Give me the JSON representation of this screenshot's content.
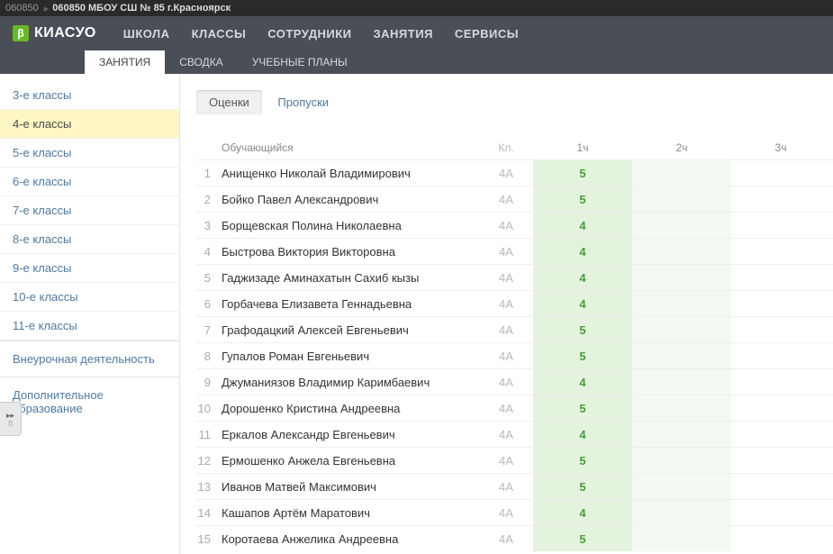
{
  "topbar": {
    "code": "060850",
    "title": "060850 МБОУ СШ № 85 г.Красноярск"
  },
  "logo": {
    "badge": "β",
    "text": "КИАСУО"
  },
  "mainnav": [
    "ШКОЛА",
    "КЛАССЫ",
    "СОТРУДНИКИ",
    "ЗАНЯТИЯ",
    "СЕРВИСЫ"
  ],
  "subnav": {
    "items": [
      "ЗАНЯТИЯ",
      "СВОДКА",
      "УЧЕБНЫЕ ПЛАНЫ"
    ],
    "active": 0
  },
  "sidebar": {
    "classes": [
      "3-е классы",
      "4-е классы",
      "5-е классы",
      "6-е классы",
      "7-е классы",
      "8-е классы",
      "9-е классы",
      "10-е классы",
      "11-е классы"
    ],
    "active": 1,
    "sections": [
      "Внеурочная деятельность",
      "Дополнительное образование"
    ]
  },
  "tabs": {
    "items": [
      "Оценки",
      "Пропуски"
    ],
    "active": 0
  },
  "table": {
    "headers": {
      "student": "Обучающийся",
      "class": "Кл.",
      "h1": "1ч",
      "h2": "2ч",
      "h3": "3ч"
    },
    "rows": [
      {
        "n": 1,
        "name": "Анищенко Николай Владимирович",
        "class": "4А",
        "g1": "5"
      },
      {
        "n": 2,
        "name": "Бойко Павел Александрович",
        "class": "4А",
        "g1": "5"
      },
      {
        "n": 3,
        "name": "Борщевская Полина Николаевна",
        "class": "4А",
        "g1": "4"
      },
      {
        "n": 4,
        "name": "Быстрова Виктория Викторовна",
        "class": "4А",
        "g1": "4"
      },
      {
        "n": 5,
        "name": "Гаджизаде Аминахатын Сахиб кызы",
        "class": "4А",
        "g1": "4"
      },
      {
        "n": 6,
        "name": "Горбачева Елизавета Геннадьевна",
        "class": "4А",
        "g1": "4"
      },
      {
        "n": 7,
        "name": "Графодацкий Алексей Евгеньевич",
        "class": "4А",
        "g1": "5"
      },
      {
        "n": 8,
        "name": "Гупалов Роман Евгеньевич",
        "class": "4А",
        "g1": "5"
      },
      {
        "n": 9,
        "name": "Джуманиязов Владимир Каримбаевич",
        "class": "4А",
        "g1": "4"
      },
      {
        "n": 10,
        "name": "Дорошенко Кристина Андреевна",
        "class": "4А",
        "g1": "5"
      },
      {
        "n": 11,
        "name": "Еркалов Александр Евгеньевич",
        "class": "4А",
        "g1": "4"
      },
      {
        "n": 12,
        "name": "Ермошенко Анжела Евгеньевна",
        "class": "4А",
        "g1": "5"
      },
      {
        "n": 13,
        "name": "Иванов Матвей Максимович",
        "class": "4А",
        "g1": "5"
      },
      {
        "n": 14,
        "name": "Кашапов Артём Маратович",
        "class": "4А",
        "g1": "4"
      },
      {
        "n": 15,
        "name": "Коротаева Анжелика Андреевна",
        "class": "4А",
        "g1": "5"
      }
    ]
  }
}
